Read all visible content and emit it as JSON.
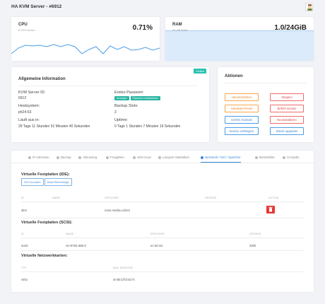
{
  "header": {
    "title": "HA KVM Server - #6912"
  },
  "cpu": {
    "label": "CPU",
    "sub": "8 CPU Kerne",
    "value": "0.71%",
    "color": "#4a9ce8"
  },
  "ram": {
    "label": "RAM",
    "sub": "24 GB RAM",
    "value": "1.0/24GiB",
    "fill": 0.04,
    "color": "#dcebfb"
  },
  "info": {
    "title": "Allgemeine Information",
    "status": "Online",
    "server_id_label": "KVM Server ID:",
    "server_id": "6912",
    "hostsystem_label": "Hostsystem:",
    "hostsystem": "ph24-53",
    "runtime_label": "Läuft aus in:",
    "runtime": "29 Tage 11 Stunden 51 Minuten 40 Sekunden",
    "password_label": "Erstes Passwort:",
    "btn_show": "Anzeigen",
    "btn_reset": "Passwort zurücksetzen",
    "backup_label": "Backup Slots:",
    "backup": "2",
    "uptime_label": "Uptime:",
    "uptime": "0 Tage 1 Stunden 7 Minuten 19 Sekunden"
  },
  "actions": {
    "title": "Aktionen",
    "shutdown": "Herunterfahren",
    "stop": "Stoppen",
    "hard_reset": "Hardware-Reset",
    "reset": "Befehl senden",
    "novnc": "noVNC Konsole",
    "reinstall": "Neuinstallieren",
    "extend": "Service verlängern",
    "upgrade": "Dienst upgraden"
  },
  "tabs": [
    "IP Adressen",
    "Backup",
    "Aktionslog",
    "Freigaben",
    "SSH Keys",
    "Langzeit Statistiken",
    "Netzwerk / ISO / Speicher",
    "Betriebslite",
    "Cronjobs"
  ],
  "ide": {
    "title": "Virtuelle Festplatten (IDE):",
    "btn_iso": "ISO mounten",
    "btn_boot": "Boot Reihenfolge",
    "cols": [
      "ID",
      "NAME",
      "SPEICHER",
      "GRÖSSE",
      "AKTION"
    ],
    "row": {
      "id": "ide2",
      "name": "",
      "storage": "none,media=cdrom",
      "size": ""
    }
  },
  "scsi": {
    "title": "Virtuelle Festplatten (SCSI):",
    "cols": [
      "ID",
      "NAME",
      "SPEICHER",
      "GRÖSSE"
    ],
    "row": {
      "id": "scsi0",
      "name": "vm-6752-disk-0",
      "storage": "ec-k4-m2",
      "size": "3000"
    }
  },
  "net": {
    "title": "Virtuelle Netzwerkkarten:",
    "cols": [
      "TYP",
      "MAC ADRESSE"
    ],
    "row": {
      "type": "virtio",
      "mac": "4e:80:1f:fd:4d:7c"
    }
  }
}
